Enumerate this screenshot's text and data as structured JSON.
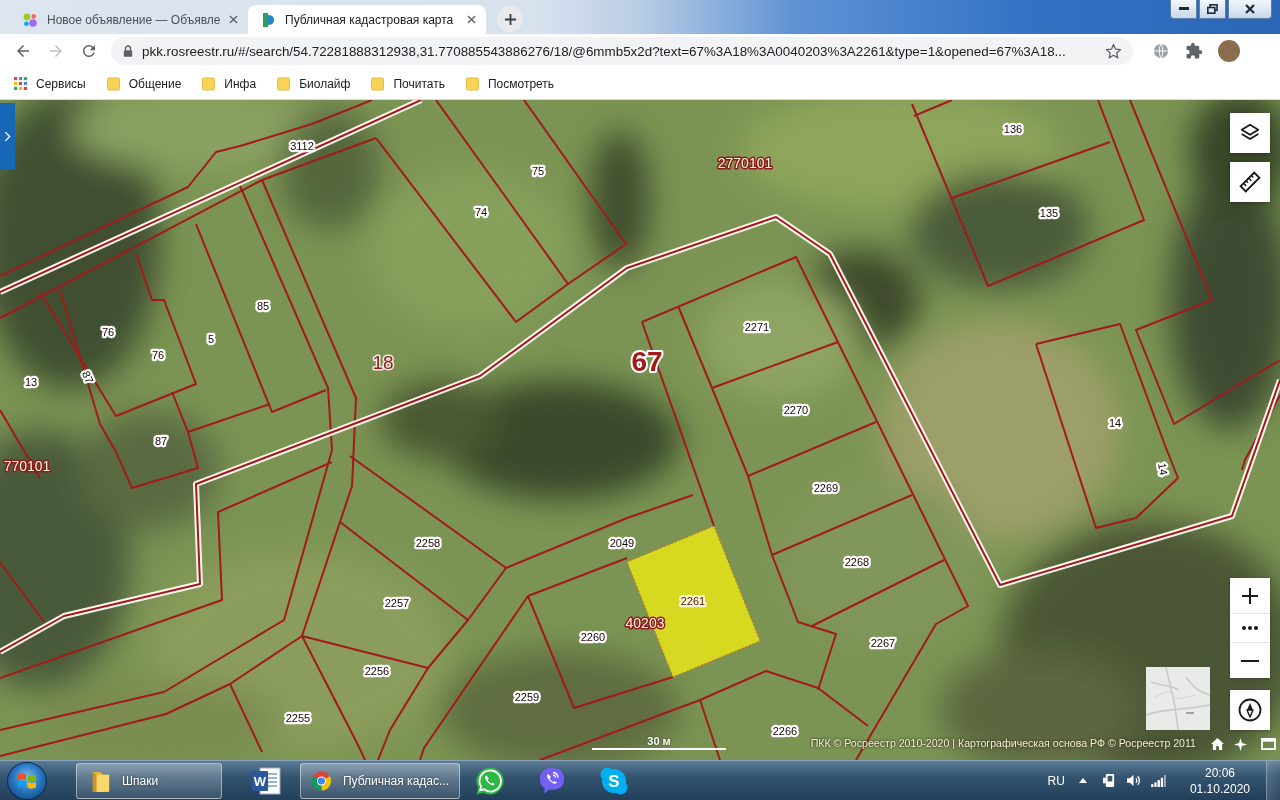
{
  "browser": {
    "tabs": [
      {
        "title": "Новое объявление — Объявле",
        "selected": false
      },
      {
        "title": "Публичная кадастровая карта",
        "selected": true
      }
    ],
    "forward": {
      "disabled": true
    },
    "address_bar": {
      "url": "pkk.rosreestr.ru/#/search/54.72281888312938,31.770885543886276/18/@6mmb5x2d?text=67%3A18%3A0040203%3A2261&type=1&opened=67%3A18..."
    },
    "bookmarks": [
      {
        "label": "Сервисы",
        "kind": "apps"
      },
      {
        "label": "Общение",
        "kind": "folder"
      },
      {
        "label": "Инфа",
        "kind": "folder"
      },
      {
        "label": "Биолайф",
        "kind": "folder"
      },
      {
        "label": "Почитать",
        "kind": "folder"
      },
      {
        "label": "Посмотреть",
        "kind": "folder"
      }
    ]
  },
  "map": {
    "labels": [
      {
        "text": "136",
        "kind": "parcel",
        "selected": false
      },
      {
        "text": "3112",
        "kind": "parcel",
        "selected": false
      },
      {
        "text": "75",
        "kind": "parcel",
        "selected": false
      },
      {
        "text": "2770101",
        "kind": "quarter",
        "selected": false
      },
      {
        "text": "74",
        "kind": "parcel",
        "selected": false
      },
      {
        "text": "135",
        "kind": "parcel",
        "selected": false
      },
      {
        "text": "85",
        "kind": "parcel",
        "selected": false
      },
      {
        "text": "76",
        "kind": "parcel",
        "selected": false
      },
      {
        "text": "5",
        "kind": "parcel",
        "selected": false
      },
      {
        "text": "2271",
        "kind": "parcel",
        "selected": false
      },
      {
        "text": "76",
        "kind": "parcel",
        "selected": false
      },
      {
        "text": "18",
        "kind": "block",
        "selected": false
      },
      {
        "text": "67",
        "kind": "region",
        "selected": false
      },
      {
        "text": "13",
        "kind": "parcel",
        "selected": false
      },
      {
        "text": "87",
        "kind": "parcel",
        "selected": false
      },
      {
        "text": "2270",
        "kind": "parcel",
        "selected": false
      },
      {
        "text": "14",
        "kind": "parcel",
        "selected": false
      },
      {
        "text": "87",
        "kind": "parcel",
        "selected": false
      },
      {
        "text": "770101",
        "kind": "quarter",
        "selected": false
      },
      {
        "text": "14",
        "kind": "parcel",
        "selected": false
      },
      {
        "text": "2269",
        "kind": "parcel",
        "selected": false
      },
      {
        "text": "2258",
        "kind": "parcel",
        "selected": false
      },
      {
        "text": "2049",
        "kind": "parcel",
        "selected": false
      },
      {
        "text": "2268",
        "kind": "parcel",
        "selected": false
      },
      {
        "text": "2257",
        "kind": "parcel",
        "selected": false
      },
      {
        "text": "2261",
        "kind": "parcel",
        "selected": true
      },
      {
        "text": "40203",
        "kind": "quarter",
        "selected": false
      },
      {
        "text": "2260",
        "kind": "parcel",
        "selected": false
      },
      {
        "text": "2267",
        "kind": "parcel",
        "selected": false
      },
      {
        "text": "2256",
        "kind": "parcel",
        "selected": false
      },
      {
        "text": "2259",
        "kind": "parcel",
        "selected": false
      },
      {
        "text": "2255",
        "kind": "parcel",
        "selected": false
      },
      {
        "text": "2266",
        "kind": "parcel",
        "selected": false
      }
    ],
    "scale": "30 м",
    "attribution": "ПКК © Росреестр 2010-2020 | Картографическая основа РФ © Росреестр 2011"
  },
  "taskbar": {
    "items": [
      {
        "kind": "explorer",
        "label": "Шпаки"
      },
      {
        "kind": "word",
        "glyph": "W"
      },
      {
        "kind": "chrome",
        "label": "Публичная кадас..."
      },
      {
        "kind": "whatsapp"
      },
      {
        "kind": "viber"
      },
      {
        "kind": "skype",
        "glyph": "S"
      }
    ],
    "language": "RU",
    "time": "20:06",
    "date": "01.10.2020"
  }
}
